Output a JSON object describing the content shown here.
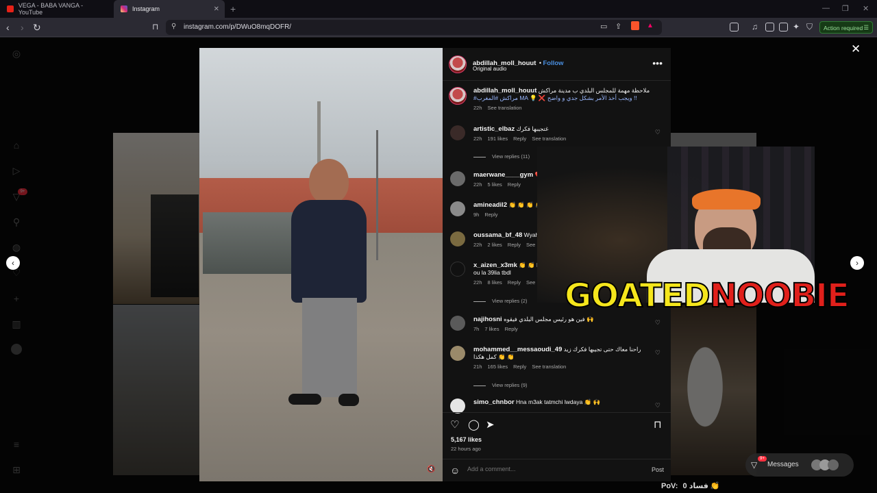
{
  "browser": {
    "tabs": [
      {
        "title": "VEGA - BABA VANGA - YouTube",
        "active": false,
        "favicon_color": "#e62117"
      },
      {
        "title": "Instagram",
        "active": true,
        "favicon_color": "#d62976"
      }
    ],
    "url": "instagram.com/p/DWuO8mqDOFR/",
    "action_required": "Action required"
  },
  "post": {
    "author": "abdillah_moll_houut",
    "follow_label": "Follow",
    "audio": "Original audio",
    "caption_text": "ملاحظة مهمة للمجلس البلدي ب مدينة مراكش",
    "caption_line2": "#مراكش #المغرب MA 💡 ❌ ويجب أخذ الأمر بشكل جدي و واضح !!",
    "caption_time": "22h",
    "see_translation": "See translation",
    "likes": "5,167 likes",
    "ago": "22 hours ago",
    "add_comment_placeholder": "Add a comment...",
    "post_label": "Post"
  },
  "comments": [
    {
      "user": "artistic_elbaz",
      "text": "غتجيبها فكرك",
      "time": "22h",
      "likes": "191 likes",
      "reply": "Reply",
      "translate": "See translation",
      "replies": "View replies (11)"
    },
    {
      "user": "maerwane____gym",
      "text": "❤️",
      "time": "22h",
      "likes": "5 likes",
      "reply": "Reply",
      "translate": "",
      "replies": ""
    },
    {
      "user": "amineadil2",
      "text": "👏 👏 👏 👏",
      "time": "9h",
      "likes": "",
      "reply": "Reply",
      "translate": "",
      "replies": ""
    },
    {
      "user": "oussama_bf_48",
      "text": "Wyah",
      "time": "22h",
      "likes": "2 likes",
      "reply": "Reply",
      "translate": "See",
      "replies": ""
    },
    {
      "user": "x_aizen_x3mk",
      "text": "👏 👏 kh",
      "text2": "ou la 39lia tbdl",
      "time": "22h",
      "likes": "8 likes",
      "reply": "Reply",
      "translate": "See",
      "replies": "View replies (2)"
    },
    {
      "user": "najihosni",
      "text": "فين هو رئيس مجلس البلدي فيقوه 🙌",
      "time": "7h",
      "likes": "7 likes",
      "reply": "Reply",
      "translate": "",
      "replies": ""
    },
    {
      "user": "mohammed__messaoudi_49",
      "text": "راحنا معاك حتى تجيبها فكرك زيد",
      "text2": "كمل هكذا 👏 👏",
      "time": "21h",
      "likes": "165 likes",
      "reply": "Reply",
      "translate": "See translation",
      "replies": "View replies (9)"
    },
    {
      "user": "simo_chnbor",
      "text": "Hna m3ak tatmchi lwdaya 👏 🙌",
      "time": "",
      "likes": "",
      "reply": "",
      "translate": "",
      "replies": ""
    }
  ],
  "overlay": {
    "goated": "GOATED",
    "noobie": "NOOBIE",
    "goated_color": "#f5e61c",
    "noobie_color": "#e0201b"
  },
  "messages": {
    "label": "Messages",
    "badge": "9+"
  },
  "sidebar_badge": "9+",
  "bottom_caption": {
    "pov": "PoV:",
    "count": "0 فساد 👏"
  }
}
